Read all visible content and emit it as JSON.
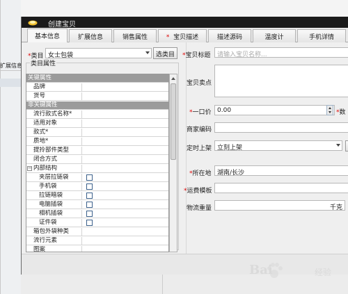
{
  "background": {
    "left_partial_label": "扩展信息"
  },
  "window": {
    "title": "创建宝贝"
  },
  "tabs": [
    {
      "label": "基本信息",
      "required": false,
      "active": true
    },
    {
      "label": "扩展信息",
      "required": false,
      "active": false
    },
    {
      "label": "销售属性",
      "required": false,
      "active": false
    },
    {
      "label": "宝贝描述",
      "required": true,
      "active": false
    },
    {
      "label": "描述源码",
      "required": false,
      "active": false
    },
    {
      "label": "温度计",
      "required": false,
      "active": false
    },
    {
      "label": "手机详情",
      "required": false,
      "active": false
    }
  ],
  "category": {
    "label": "类目",
    "required_mark": "*",
    "value": "女士包袋",
    "select_button": "选类目"
  },
  "attributes": {
    "group_label": "类目属性",
    "rows": [
      {
        "name": "关键属性",
        "type": "section"
      },
      {
        "name": "品牌",
        "type": "indent"
      },
      {
        "name": "货号",
        "type": "indent"
      },
      {
        "name": "非关键属性",
        "type": "section"
      },
      {
        "name": "流行款式名称*",
        "type": "plain"
      },
      {
        "name": "适用对象",
        "type": "plain"
      },
      {
        "name": "款式*",
        "type": "plain"
      },
      {
        "name": "质地*",
        "type": "plain"
      },
      {
        "name": "提拎部件类型",
        "type": "plain"
      },
      {
        "name": "闭合方式",
        "type": "plain"
      },
      {
        "name": "内部结构",
        "type": "expand",
        "expander": "−"
      },
      {
        "name": "夹层拉链袋",
        "type": "check"
      },
      {
        "name": "手机袋",
        "type": "check"
      },
      {
        "name": "拉链暗袋",
        "type": "check"
      },
      {
        "name": "电脑插袋",
        "type": "check"
      },
      {
        "name": "相机插袋",
        "type": "check"
      },
      {
        "name": "证件袋",
        "type": "check"
      },
      {
        "name": "箱包外袋种类",
        "type": "plain"
      },
      {
        "name": "流行元素",
        "type": "plain"
      },
      {
        "name": "图案",
        "type": "plain"
      }
    ]
  },
  "form": {
    "title_label": "宝贝标题",
    "title_placeholder": "请输入宝贝名称...",
    "selling_point_label": "宝贝卖点",
    "price_label": "一口价",
    "price_value": "0.00",
    "quantity_label_partial": "数",
    "merchant_code_label": "商家编码",
    "listing_label": "定时上架",
    "listing_value": "立刻上架",
    "location_label": "所在地",
    "location_value": "湖南/长沙",
    "shipping_template_label": "运费模板",
    "weight_label": "物流重量",
    "weight_unit": "千克",
    "required_mark": "*"
  },
  "watermark": {
    "text": "Bai",
    "sub": "经验"
  }
}
